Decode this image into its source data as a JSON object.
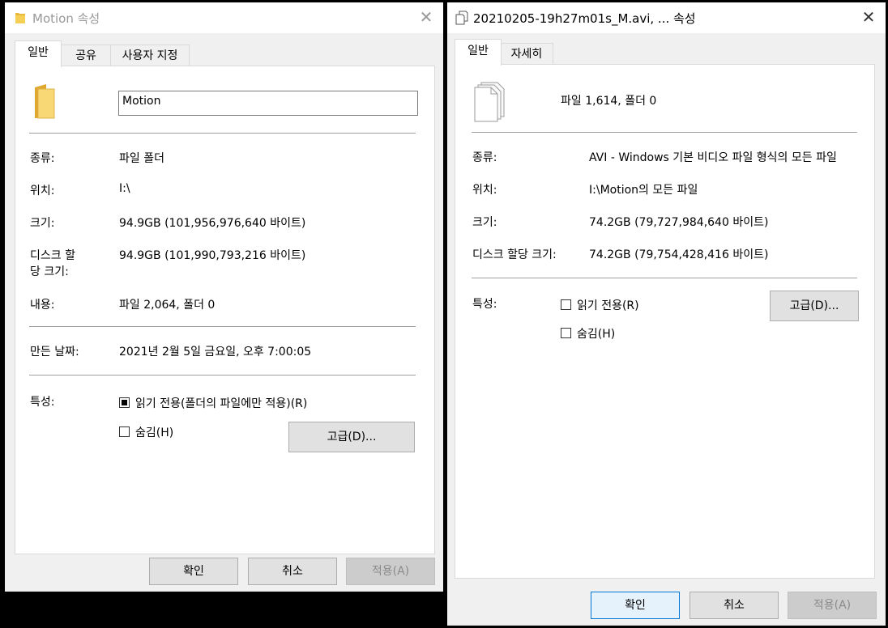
{
  "left_dialog": {
    "title": "Motion 속성",
    "tabs": [
      "일반",
      "공유",
      "사용자 지정"
    ],
    "name_value": "Motion",
    "type_label": "종류:",
    "type_value": "파일 폴더",
    "location_label": "위치:",
    "location_value": "I:\\",
    "size_label": "크기:",
    "size_value": "94.9GB (101,956,976,640 바이트)",
    "disk_size_label_1": "디스크 할",
    "disk_size_label_2": "당 크기:",
    "disk_size_value": "94.9GB (101,990,793,216 바이트)",
    "contents_label": "내용:",
    "contents_value": "파일 2,064, 폴더 0",
    "created_label": "만든 날짜:",
    "created_value": "2021년 2월 5일 금요일, 오후 7:00:05",
    "attributes_label": "특성:",
    "readonly_label": "읽기 전용(폴더의 파일에만 적용)(R)",
    "hidden_label": "숨김(H)",
    "advanced_button": "고급(D)...",
    "ok_button": "확인",
    "cancel_button": "취소",
    "apply_button": "적용(A)"
  },
  "right_dialog": {
    "title": "20210205-19h27m01s_M.avi, ... 속성",
    "tabs": [
      "일반",
      "자세히"
    ],
    "summary": "파일 1,614, 폴더 0",
    "type_label": "종류:",
    "type_value": "AVI - Windows 기본 비디오 파일 형식의 모든 파일",
    "location_label": "위치:",
    "location_value": "I:\\Motion의 모든 파일",
    "size_label": "크기:",
    "size_value": "74.2GB (79,727,984,640 바이트)",
    "disk_size_label": "디스크 할당 크기:",
    "disk_size_value": "74.2GB (79,754,428,416 바이트)",
    "attributes_label": "특성:",
    "readonly_label": "읽기 전용(R)",
    "hidden_label": "숨김(H)",
    "advanced_button": "고급(D)...",
    "ok_button": "확인",
    "cancel_button": "취소",
    "apply_button": "적용(A)"
  }
}
